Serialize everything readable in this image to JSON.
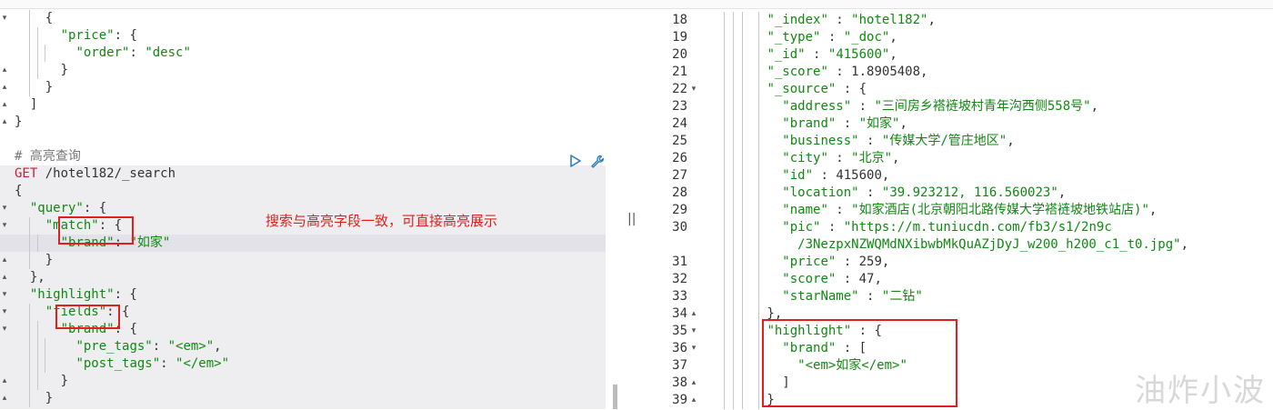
{
  "left_editor": {
    "lines": [
      {
        "fold": "▾",
        "parts": [
          [
            "p",
            "    {"
          ]
        ]
      },
      {
        "fold": "",
        "parts": [
          [
            "p",
            "      "
          ],
          [
            "k",
            "\"price\""
          ],
          [
            "p",
            ": {"
          ]
        ]
      },
      {
        "fold": "",
        "parts": [
          [
            "p",
            "        "
          ],
          [
            "k",
            "\"order\""
          ],
          [
            "p",
            ": "
          ],
          [
            "s",
            "\"desc\""
          ]
        ]
      },
      {
        "fold": "▴",
        "parts": [
          [
            "p",
            "      }"
          ]
        ]
      },
      {
        "fold": "▴",
        "parts": [
          [
            "p",
            "    }"
          ]
        ]
      },
      {
        "fold": "▴",
        "parts": [
          [
            "p",
            "  ]"
          ]
        ]
      },
      {
        "fold": "▴",
        "parts": [
          [
            "p",
            "}"
          ]
        ]
      },
      {
        "fold": "",
        "parts": [
          [
            "p",
            ""
          ]
        ]
      },
      {
        "fold": "",
        "parts": [
          [
            "c",
            "# 高亮查询"
          ]
        ]
      },
      {
        "fold": "",
        "req": true,
        "parts": [
          [
            "m",
            "GET "
          ],
          [
            "u",
            "/hotel182/_search"
          ]
        ]
      },
      {
        "fold": "",
        "req": true,
        "parts": [
          [
            "p",
            "{"
          ]
        ]
      },
      {
        "fold": "▾",
        "req": true,
        "parts": [
          [
            "p",
            "  "
          ],
          [
            "k",
            "\"query\""
          ],
          [
            "p",
            ": {"
          ]
        ]
      },
      {
        "fold": "▾",
        "req": true,
        "parts": [
          [
            "p",
            "    "
          ],
          [
            "k",
            "\"match\""
          ],
          [
            "p",
            ": {"
          ]
        ]
      },
      {
        "fold": "",
        "req": true,
        "cur": true,
        "parts": [
          [
            "p",
            "      "
          ],
          [
            "k",
            "\"brand\""
          ],
          [
            "p",
            ": "
          ],
          [
            "s",
            "\"如家\""
          ]
        ]
      },
      {
        "fold": "▴",
        "req": true,
        "parts": [
          [
            "p",
            "    }"
          ]
        ]
      },
      {
        "fold": "▴",
        "req": true,
        "parts": [
          [
            "p",
            "  },"
          ]
        ]
      },
      {
        "fold": "▾",
        "req": true,
        "parts": [
          [
            "p",
            "  "
          ],
          [
            "k",
            "\"highlight\""
          ],
          [
            "p",
            ": {"
          ]
        ]
      },
      {
        "fold": "▾",
        "req": true,
        "parts": [
          [
            "p",
            "    "
          ],
          [
            "k",
            "\"fields\""
          ],
          [
            "p",
            ": {"
          ]
        ]
      },
      {
        "fold": "▾",
        "req": true,
        "parts": [
          [
            "p",
            "      "
          ],
          [
            "k",
            "\"brand\""
          ],
          [
            "p",
            ": {"
          ]
        ]
      },
      {
        "fold": "",
        "req": true,
        "parts": [
          [
            "p",
            "        "
          ],
          [
            "k",
            "\"pre_tags\""
          ],
          [
            "p",
            ": "
          ],
          [
            "s",
            "\"<em>\""
          ],
          [
            "p",
            ","
          ]
        ]
      },
      {
        "fold": "",
        "req": true,
        "parts": [
          [
            "p",
            "        "
          ],
          [
            "k",
            "\"post_tags\""
          ],
          [
            "p",
            ": "
          ],
          [
            "s",
            "\"</em>\""
          ]
        ]
      },
      {
        "fold": "▴",
        "req": true,
        "parts": [
          [
            "p",
            "      }"
          ]
        ]
      },
      {
        "fold": "▴",
        "req": true,
        "parts": [
          [
            "p",
            "    }"
          ]
        ]
      },
      {
        "fold": "▴",
        "req": true,
        "parts": [
          [
            "p",
            "  }"
          ]
        ]
      }
    ],
    "annotation": "搜索与高亮字段一致，可直接高亮展示"
  },
  "right_editor": {
    "lines": [
      {
        "num": "18",
        "fold": "",
        "parts": [
          [
            "p",
            "        "
          ],
          [
            "k",
            "\"_index\""
          ],
          [
            "p",
            " : "
          ],
          [
            "s",
            "\"hotel182\""
          ],
          [
            "p",
            ","
          ]
        ]
      },
      {
        "num": "19",
        "fold": "",
        "parts": [
          [
            "p",
            "        "
          ],
          [
            "k",
            "\"_type\""
          ],
          [
            "p",
            " : "
          ],
          [
            "s",
            "\"_doc\""
          ],
          [
            "p",
            ","
          ]
        ]
      },
      {
        "num": "20",
        "fold": "",
        "parts": [
          [
            "p",
            "        "
          ],
          [
            "k",
            "\"_id\""
          ],
          [
            "p",
            " : "
          ],
          [
            "s",
            "\"415600\""
          ],
          [
            "p",
            ","
          ]
        ]
      },
      {
        "num": "21",
        "fold": "",
        "parts": [
          [
            "p",
            "        "
          ],
          [
            "k",
            "\"_score\""
          ],
          [
            "p",
            " : "
          ],
          [
            "n",
            "1.8905408"
          ],
          [
            "p",
            ","
          ]
        ]
      },
      {
        "num": "22",
        "fold": "▾",
        "parts": [
          [
            "p",
            "        "
          ],
          [
            "k",
            "\"_source\""
          ],
          [
            "p",
            " : {"
          ]
        ]
      },
      {
        "num": "23",
        "fold": "",
        "parts": [
          [
            "p",
            "          "
          ],
          [
            "k",
            "\"address\""
          ],
          [
            "p",
            " : "
          ],
          [
            "s",
            "\"三间房乡褡裢坡村青年沟西侧558号\""
          ],
          [
            "p",
            ","
          ]
        ]
      },
      {
        "num": "24",
        "fold": "",
        "parts": [
          [
            "p",
            "          "
          ],
          [
            "k",
            "\"brand\""
          ],
          [
            "p",
            " : "
          ],
          [
            "s",
            "\"如家\""
          ],
          [
            "p",
            ","
          ]
        ]
      },
      {
        "num": "25",
        "fold": "",
        "parts": [
          [
            "p",
            "          "
          ],
          [
            "k",
            "\"business\""
          ],
          [
            "p",
            " : "
          ],
          [
            "s",
            "\"传媒大学/管庄地区\""
          ],
          [
            "p",
            ","
          ]
        ]
      },
      {
        "num": "26",
        "fold": "",
        "parts": [
          [
            "p",
            "          "
          ],
          [
            "k",
            "\"city\""
          ],
          [
            "p",
            " : "
          ],
          [
            "s",
            "\"北京\""
          ],
          [
            "p",
            ","
          ]
        ]
      },
      {
        "num": "27",
        "fold": "",
        "parts": [
          [
            "p",
            "          "
          ],
          [
            "k",
            "\"id\""
          ],
          [
            "p",
            " : "
          ],
          [
            "n",
            "415600"
          ],
          [
            "p",
            ","
          ]
        ]
      },
      {
        "num": "28",
        "fold": "",
        "parts": [
          [
            "p",
            "          "
          ],
          [
            "k",
            "\"location\""
          ],
          [
            "p",
            " : "
          ],
          [
            "s",
            "\"39.923212, 116.560023\""
          ],
          [
            "p",
            ","
          ]
        ]
      },
      {
        "num": "29",
        "fold": "",
        "parts": [
          [
            "p",
            "          "
          ],
          [
            "k",
            "\"name\""
          ],
          [
            "p",
            " : "
          ],
          [
            "s",
            "\"如家酒店(北京朝阳北路传媒大学褡裢坡地铁站店)\""
          ],
          [
            "p",
            ","
          ]
        ]
      },
      {
        "num": "30",
        "fold": "",
        "parts": [
          [
            "p",
            "          "
          ],
          [
            "k",
            "\"pic\""
          ],
          [
            "p",
            " : "
          ],
          [
            "s",
            "\"https://m.tuniucdn.com/fb3/s1/2n9c"
          ]
        ]
      },
      {
        "num": "",
        "fold": "",
        "parts": [
          [
            "s",
            "            /3NezpxNZWQMdNXibwbMkQuAZjDyJ_w200_h200_c1_t0.jpg\""
          ],
          [
            "p",
            ","
          ]
        ]
      },
      {
        "num": "31",
        "fold": "",
        "parts": [
          [
            "p",
            "          "
          ],
          [
            "k",
            "\"price\""
          ],
          [
            "p",
            " : "
          ],
          [
            "n",
            "259"
          ],
          [
            "p",
            ","
          ]
        ]
      },
      {
        "num": "32",
        "fold": "",
        "parts": [
          [
            "p",
            "          "
          ],
          [
            "k",
            "\"score\""
          ],
          [
            "p",
            " : "
          ],
          [
            "n",
            "47"
          ],
          [
            "p",
            ","
          ]
        ]
      },
      {
        "num": "33",
        "fold": "",
        "parts": [
          [
            "p",
            "          "
          ],
          [
            "k",
            "\"starName\""
          ],
          [
            "p",
            " : "
          ],
          [
            "s",
            "\"二钻\""
          ]
        ]
      },
      {
        "num": "34",
        "fold": "▴",
        "parts": [
          [
            "p",
            "        },"
          ]
        ]
      },
      {
        "num": "35",
        "fold": "▾",
        "parts": [
          [
            "p",
            "        "
          ],
          [
            "k",
            "\"highlight\""
          ],
          [
            "p",
            " : {"
          ]
        ]
      },
      {
        "num": "36",
        "fold": "▾",
        "parts": [
          [
            "p",
            "          "
          ],
          [
            "k",
            "\"brand\""
          ],
          [
            "p",
            " : ["
          ]
        ]
      },
      {
        "num": "37",
        "fold": "",
        "parts": [
          [
            "p",
            "            "
          ],
          [
            "s",
            "\"<em>如家</em>\""
          ]
        ]
      },
      {
        "num": "38",
        "fold": "▴",
        "parts": [
          [
            "p",
            "          ]"
          ]
        ]
      },
      {
        "num": "39",
        "fold": "▴",
        "parts": [
          [
            "p",
            "        }"
          ]
        ]
      }
    ]
  },
  "toolbar": {
    "run_icon": "play-icon",
    "settings_icon": "wrench-icon"
  },
  "divider_grip": "||",
  "watermark": "油炸小波",
  "colors": {
    "key": "#118811",
    "method": "#c41e3a",
    "annotation": "#e0201c"
  }
}
